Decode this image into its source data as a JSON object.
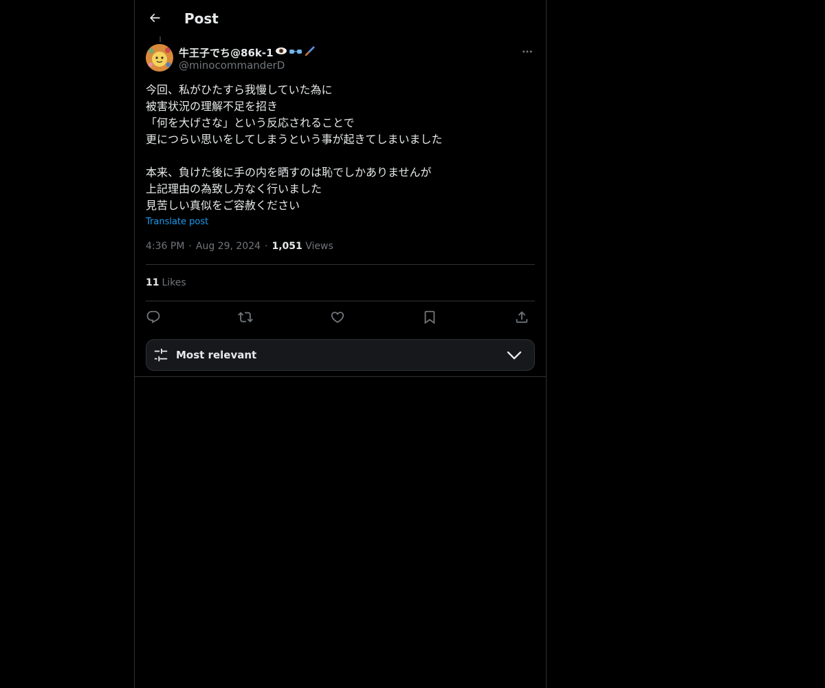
{
  "header": {
    "title": "Post"
  },
  "author": {
    "display_name": "牛王子でち@86k-1",
    "name_emojis": [
      "eye-emoji",
      "glasses-emoji",
      "paintbrush-emoji"
    ],
    "handle": "@minocommanderD"
  },
  "post": {
    "lines": [
      "今回、私がひたすら我慢していた為に",
      "被害状況の理解不足を招き",
      "「何を大げさな」という反応されることで",
      "更につらい思いをしてしまうという事が起きてしまいました",
      "",
      "本来、負けた後に手の内を晒すのは恥でしかありませんが",
      "上記理由の為致し方なく行いました",
      "見苦しい真似をご容赦ください"
    ],
    "translate_label": "Translate post",
    "time": "4:36 PM",
    "date": "Aug 29, 2024",
    "views_count": "1,051",
    "views_label": "Views",
    "likes_count": "11",
    "likes_label": "Likes"
  },
  "actions": [
    "reply-icon",
    "repost-icon",
    "like-icon",
    "bookmark-icon",
    "share-icon"
  ],
  "sort": {
    "label": "Most relevant"
  },
  "colors": {
    "background": "#000000",
    "text_primary": "#e7e9ea",
    "text_secondary": "#71767b",
    "accent_link": "#1d9bf0",
    "border": "#2f3336",
    "sort_bar_bg": "#16181c"
  }
}
